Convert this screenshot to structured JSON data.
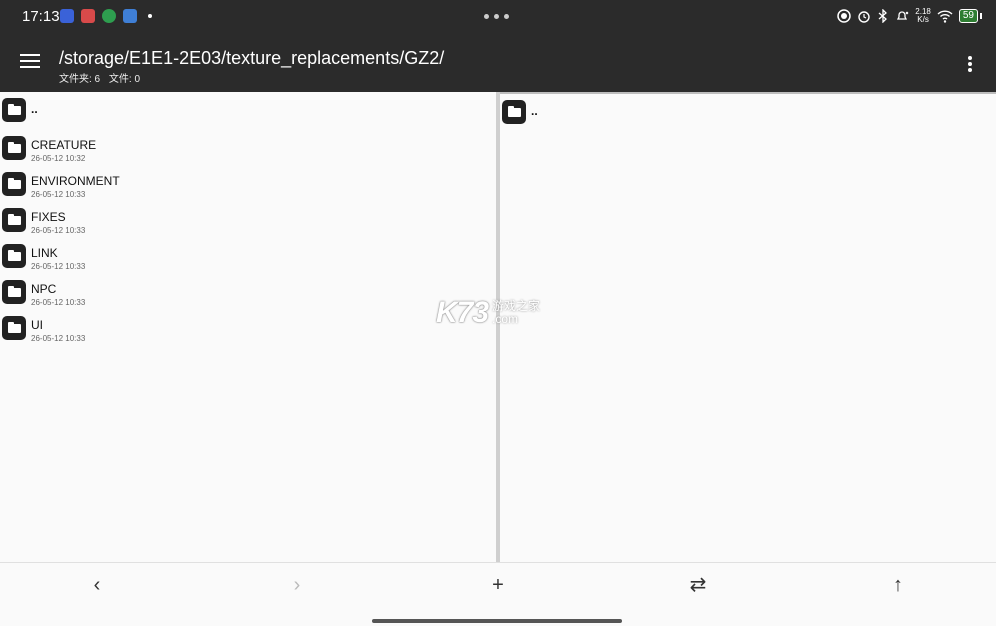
{
  "status_bar": {
    "time": "17:13",
    "battery": "59",
    "net_speed_value": "2.18",
    "net_speed_unit": "K/s",
    "app_icon_colors": [
      "#3a62d8",
      "#d84a4a",
      "#2e9e4f",
      "#3f7fd6"
    ]
  },
  "app_bar": {
    "path": "/storage/E1E1-2E03/texture_replacements/GZ2/",
    "folder_count": "文件夹: 6",
    "file_count": "文件: 0"
  },
  "left_pane": {
    "parent_label": "..",
    "items": [
      {
        "name": "CREATURE",
        "date": "26-05-12 10:32"
      },
      {
        "name": "ENVIRONMENT",
        "date": "26-05-12 10:33"
      },
      {
        "name": "FIXES",
        "date": "26-05-12 10:33"
      },
      {
        "name": "LINK",
        "date": "26-05-12 10:33"
      },
      {
        "name": "NPC",
        "date": "26-05-12 10:33"
      },
      {
        "name": "UI",
        "date": "26-05-12 10:33"
      }
    ]
  },
  "right_pane": {
    "parent_label": ".."
  },
  "watermark": {
    "logo": "K73",
    "line1": "游戏之家",
    "line2": ".com"
  },
  "bottom_nav": {
    "back_icon": "‹",
    "forward_icon": "›",
    "add_icon": "+",
    "swap_icon": "⇄",
    "up_icon": "↑"
  }
}
